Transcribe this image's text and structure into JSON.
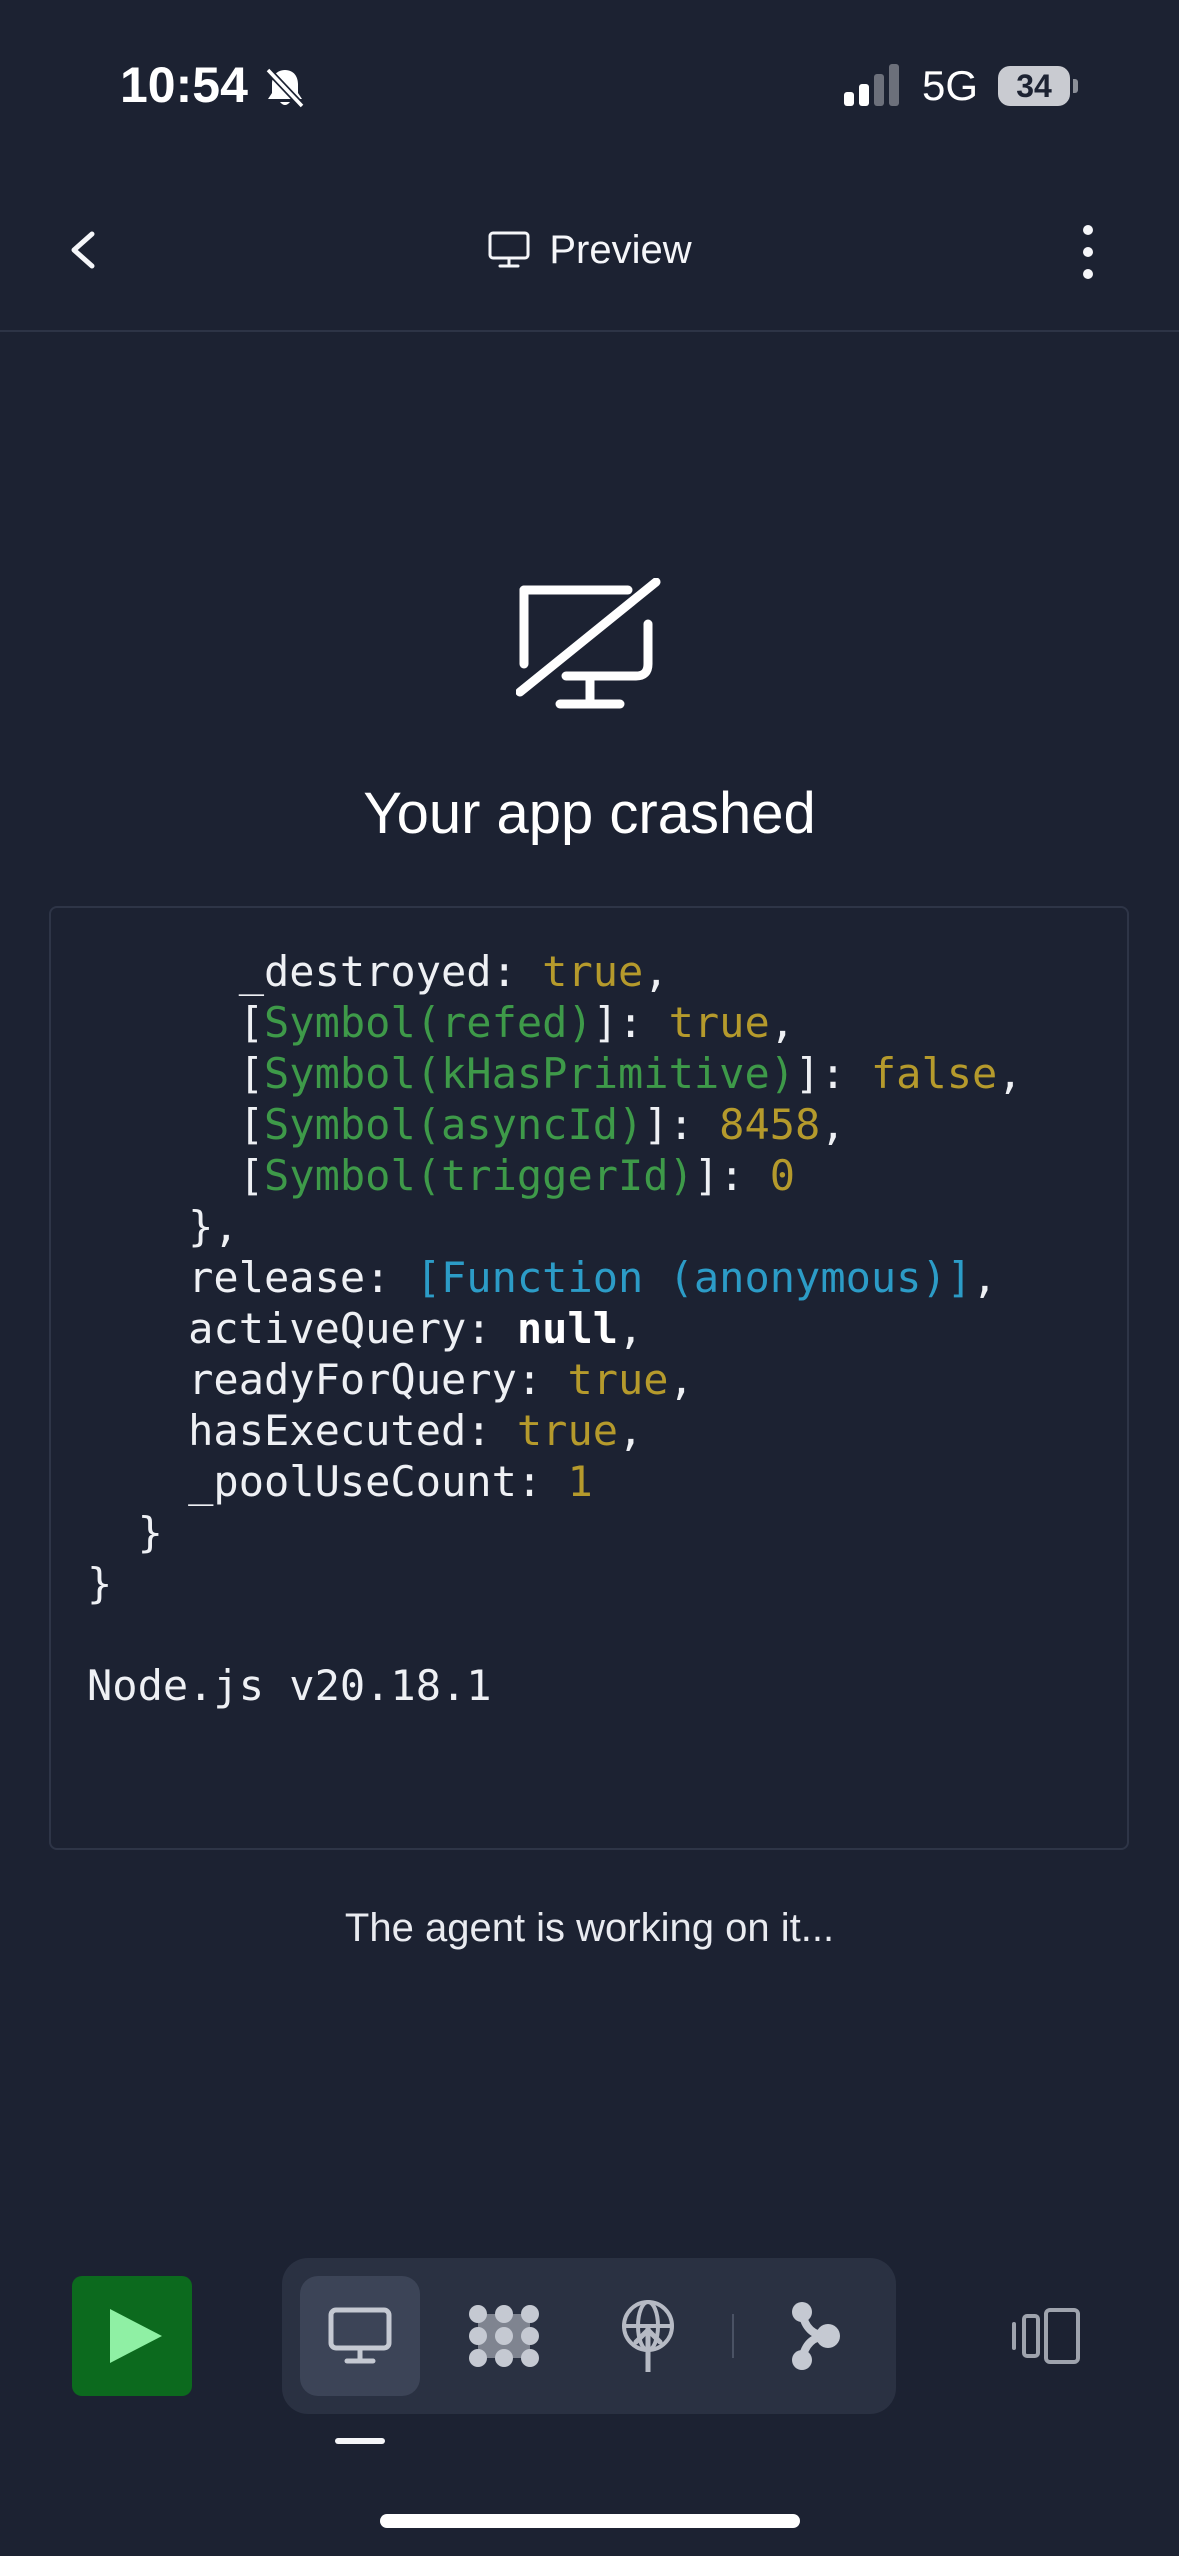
{
  "status_bar": {
    "time": "10:54",
    "network": "5G",
    "battery": "34"
  },
  "header": {
    "title": "Preview"
  },
  "crash": {
    "title": "Your app crashed",
    "log_lines": [
      [
        {
          "t": "      _destroyed: ",
          "c": "p"
        },
        {
          "t": "true",
          "c": "bool"
        },
        {
          "t": ",",
          "c": "p"
        }
      ],
      [
        {
          "t": "      [",
          "c": "p"
        },
        {
          "t": "Symbol(refed)",
          "c": "sym"
        },
        {
          "t": "]: ",
          "c": "p"
        },
        {
          "t": "true",
          "c": "bool"
        },
        {
          "t": ",",
          "c": "p"
        }
      ],
      [
        {
          "t": "      [",
          "c": "p"
        },
        {
          "t": "Symbol(kHasPrimitive)",
          "c": "sym"
        },
        {
          "t": "]: ",
          "c": "p"
        },
        {
          "t": "false",
          "c": "bool"
        },
        {
          "t": ",",
          "c": "p"
        }
      ],
      [
        {
          "t": "      [",
          "c": "p"
        },
        {
          "t": "Symbol(asyncId)",
          "c": "sym"
        },
        {
          "t": "]: ",
          "c": "p"
        },
        {
          "t": "8458",
          "c": "num"
        },
        {
          "t": ",",
          "c": "p"
        }
      ],
      [
        {
          "t": "      [",
          "c": "p"
        },
        {
          "t": "Symbol(triggerId)",
          "c": "sym"
        },
        {
          "t": "]: ",
          "c": "p"
        },
        {
          "t": "0",
          "c": "num"
        }
      ],
      [
        {
          "t": "    },",
          "c": "p"
        }
      ],
      [
        {
          "t": "    release: ",
          "c": "p"
        },
        {
          "t": "[Function (anonymous)]",
          "c": "fn"
        },
        {
          "t": ",",
          "c": "p"
        }
      ],
      [
        {
          "t": "    activeQuery: ",
          "c": "p"
        },
        {
          "t": "null",
          "c": "null"
        },
        {
          "t": ",",
          "c": "p"
        }
      ],
      [
        {
          "t": "    readyForQuery: ",
          "c": "p"
        },
        {
          "t": "true",
          "c": "bool"
        },
        {
          "t": ",",
          "c": "p"
        }
      ],
      [
        {
          "t": "    hasExecuted: ",
          "c": "p"
        },
        {
          "t": "true",
          "c": "bool"
        },
        {
          "t": ",",
          "c": "p"
        }
      ],
      [
        {
          "t": "    _poolUseCount: ",
          "c": "p"
        },
        {
          "t": "1",
          "c": "num"
        }
      ],
      [
        {
          "t": "  }",
          "c": "p"
        }
      ],
      [
        {
          "t": "}",
          "c": "p"
        }
      ],
      [
        {
          "t": "",
          "c": "p"
        }
      ],
      [
        {
          "t": "Node.js v20.18.1",
          "c": "p"
        }
      ]
    ]
  },
  "agent_status": "The agent is working on it...",
  "icons": {
    "back": "chevron-left-icon",
    "preview": "monitor-icon",
    "more": "more-vertical-icon",
    "crash": "monitor-off-icon",
    "run": "play-icon",
    "tabs": [
      "monitor-icon",
      "grid-dots-icon",
      "deploy-globe-icon",
      "workflow-icon"
    ],
    "panels": "panels-icon"
  },
  "colors": {
    "background": "#1c2232",
    "run_button": "#0c6a1e",
    "play": "#8ff0a4",
    "bool_num": "#b59a2c",
    "symbol": "#3e9a49",
    "function": "#2c9cc7"
  }
}
